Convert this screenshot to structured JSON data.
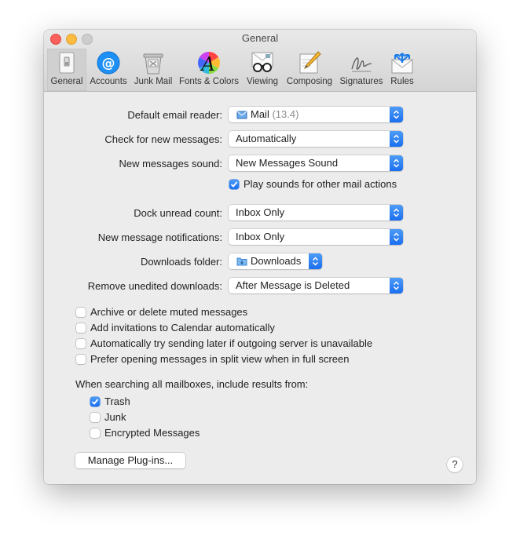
{
  "window": {
    "title": "General"
  },
  "toolbar": [
    {
      "label": "General",
      "icon": "general-switch-icon",
      "selected": true
    },
    {
      "label": "Accounts",
      "icon": "at-sign-icon"
    },
    {
      "label": "Junk Mail",
      "icon": "junk-bin-icon"
    },
    {
      "label": "Fonts & Colors",
      "icon": "color-wheel-icon"
    },
    {
      "label": "Viewing",
      "icon": "glasses-icon"
    },
    {
      "label": "Composing",
      "icon": "pencil-icon"
    },
    {
      "label": "Signatures",
      "icon": "signature-icon"
    },
    {
      "label": "Rules",
      "icon": "envelope-arrows-icon"
    }
  ],
  "settings": {
    "default_reader": {
      "label": "Default email reader:",
      "value": "Mail",
      "version": "(13.4)"
    },
    "check_messages": {
      "label": "Check for new messages:",
      "value": "Automatically"
    },
    "new_sound": {
      "label": "New messages sound:",
      "value": "New Messages Sound"
    },
    "play_sounds": {
      "label": "Play sounds for other mail actions",
      "checked": true
    },
    "dock_count": {
      "label": "Dock unread count:",
      "value": "Inbox Only"
    },
    "notifications": {
      "label": "New message notifications:",
      "value": "Inbox Only"
    },
    "downloads_folder": {
      "label": "Downloads folder:",
      "value": "Downloads"
    },
    "remove_downloads": {
      "label": "Remove unedited downloads:",
      "value": "After Message is Deleted"
    }
  },
  "options": [
    {
      "label": "Archive or delete muted messages",
      "checked": false
    },
    {
      "label": "Add invitations to Calendar automatically",
      "checked": false
    },
    {
      "label": "Automatically try sending later if outgoing server is unavailable",
      "checked": false
    },
    {
      "label": "Prefer opening messages in split view when in full screen",
      "checked": false
    }
  ],
  "search": {
    "label": "When searching all mailboxes, include results from:",
    "items": [
      {
        "label": "Trash",
        "checked": true
      },
      {
        "label": "Junk",
        "checked": false
      },
      {
        "label": "Encrypted Messages",
        "checked": false
      }
    ]
  },
  "buttons": {
    "manage_plugins": "Manage Plug-ins...",
    "help": "?"
  },
  "colors": {
    "accent": "#1a6ff0",
    "window_bg": "#ececec"
  }
}
